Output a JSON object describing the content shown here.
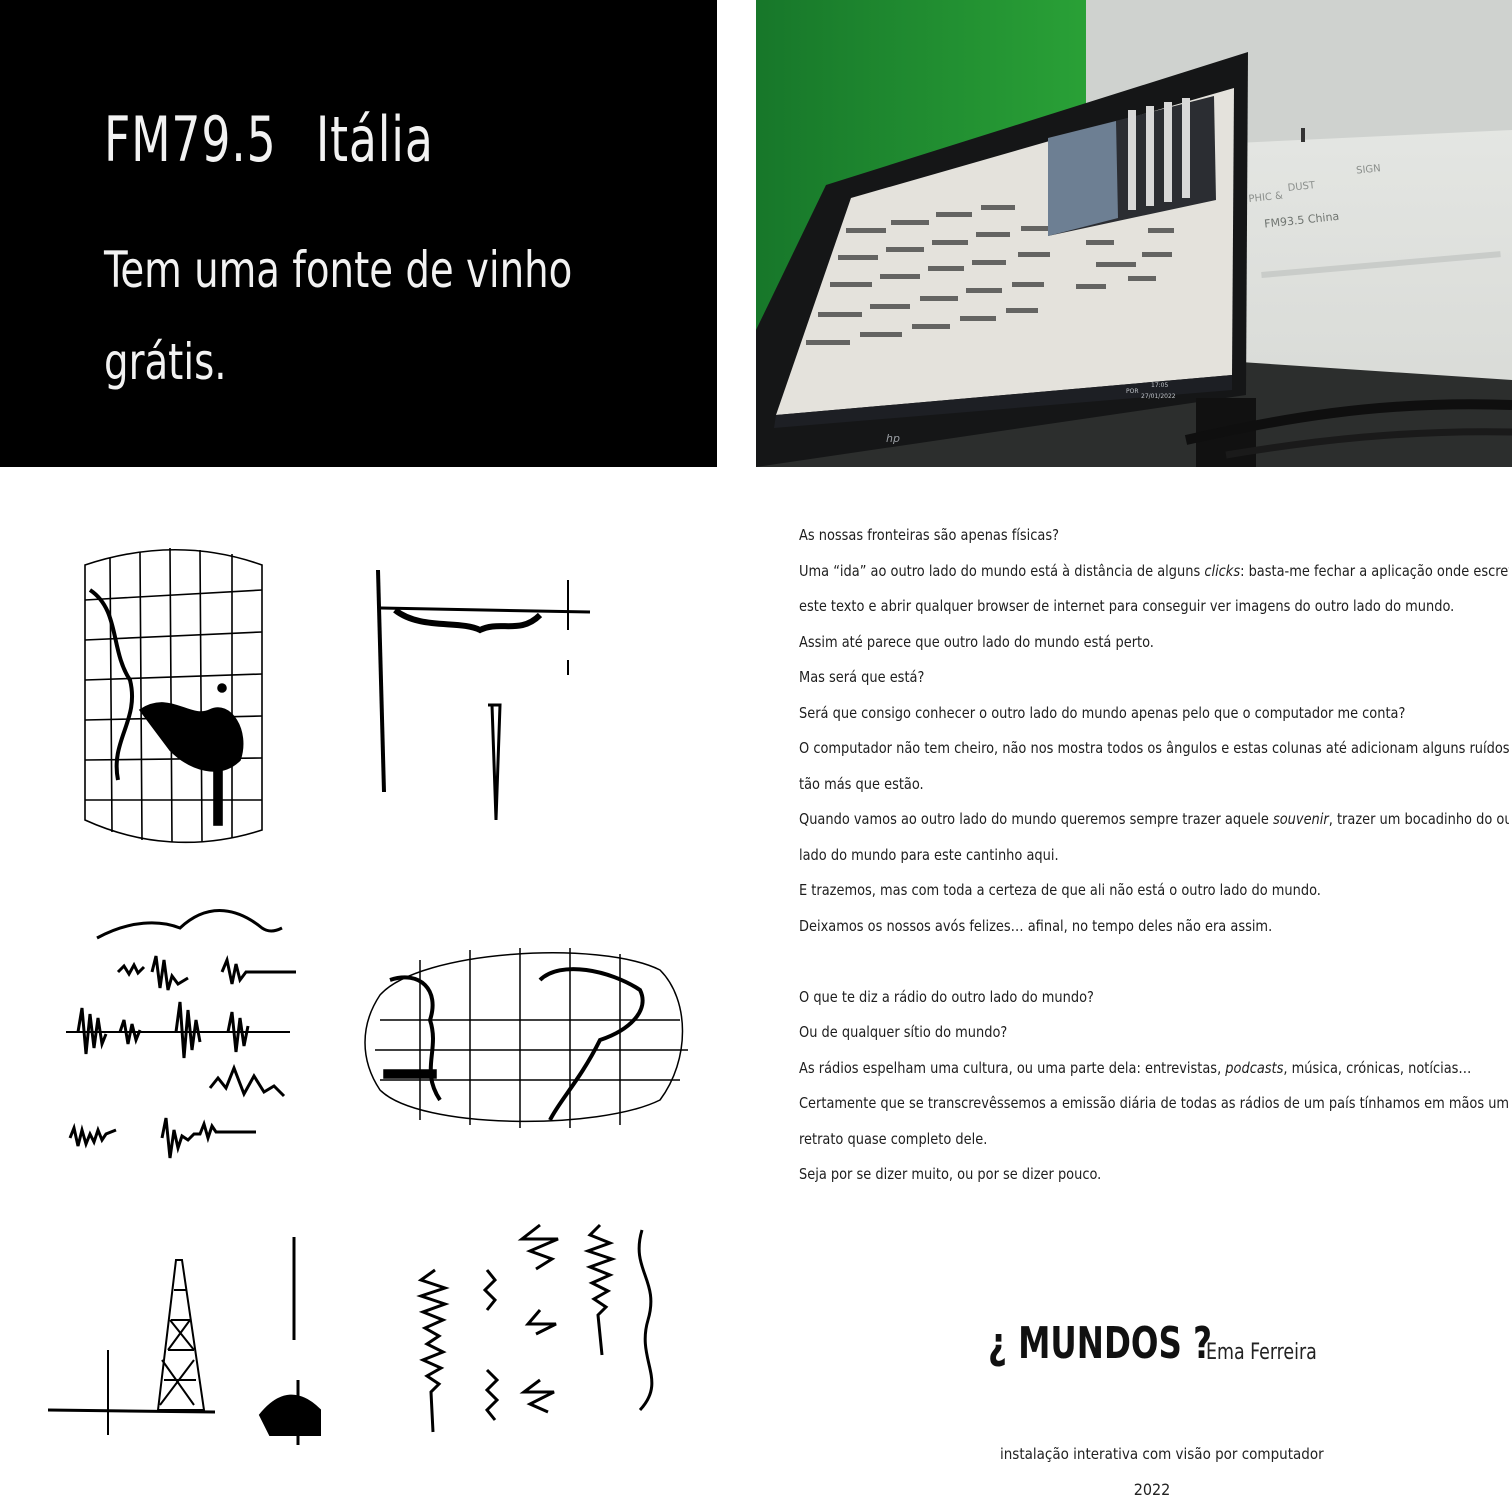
{
  "slide": {
    "station_code": "FM79.5",
    "country": "Itália",
    "message": "Tem uma fonte de vinho grátis."
  },
  "photo": {
    "monitor_brand": "hp",
    "projection_line1_a": "PHIC &",
    "projection_line1_b": "DUST",
    "projection_line1_c": "SIGN",
    "projection_line2": "FM93.5 China",
    "taskbar_lang": "POR",
    "taskbar_time": "17:05",
    "taskbar_date": "27/01/2022",
    "colors": {
      "green_wall": "#1f8a2a",
      "screen": "#e4e2dc"
    }
  },
  "essay": {
    "lines": [
      {
        "text": "As nossas fronteiras são apenas físicas?"
      },
      {
        "pre": "Uma “ida” ao outro lado do mundo está à distância de alguns ",
        "em": "clicks",
        "post": ": basta-me fechar a aplicação onde escrevo"
      },
      {
        "text": "este texto e abrir qualquer browser de internet para conseguir ver imagens do outro lado do mundo."
      },
      {
        "text": "Assim até parece que outro lado do mundo está perto."
      },
      {
        "text": "Mas será que está?"
      },
      {
        "text": "Será que consigo conhecer o outro lado do mundo apenas pelo que o computador me conta?"
      },
      {
        "text": "O computador não tem cheiro, não nos mostra todos os ângulos e estas colunas até adicionam alguns ruídos de"
      },
      {
        "text": "tão más que estão."
      },
      {
        "pre": "Quando vamos ao outro lado do mundo queremos sempre trazer aquele ",
        "em": "souvenir",
        "post": ", trazer um bocadinho do outro"
      },
      {
        "text": "lado do mundo para este cantinho aqui."
      },
      {
        "text": "E trazemos, mas com toda a certeza de que ali não está o outro lado do mundo."
      },
      {
        "text": "Deixamos os nossos avós felizes… afinal, no tempo deles não era assim."
      },
      {
        "text": ""
      },
      {
        "text": "O que te diz a rádio do outro lado do mundo?"
      },
      {
        "text": "Ou de qualquer sítio do mundo?"
      },
      {
        "pre": "As rádios espelham uma cultura, ou uma parte dela: entrevistas, ",
        "em": "podcasts",
        "post": ", música, crónicas, notícias…"
      },
      {
        "text": "Certamente que se transcrevêssemos a emissão diária de todas as rádios de um país tínhamos em mãos um"
      },
      {
        "text": "retrato quase completo dele."
      },
      {
        "text": "Seja por se dizer muito, ou por se dizer pouco."
      }
    ]
  },
  "credits": {
    "title": "¿ MUNDOS ?",
    "author": "Ema Ferreira",
    "subtitle": "instalação interativa com visão por computador",
    "year": "2022"
  }
}
